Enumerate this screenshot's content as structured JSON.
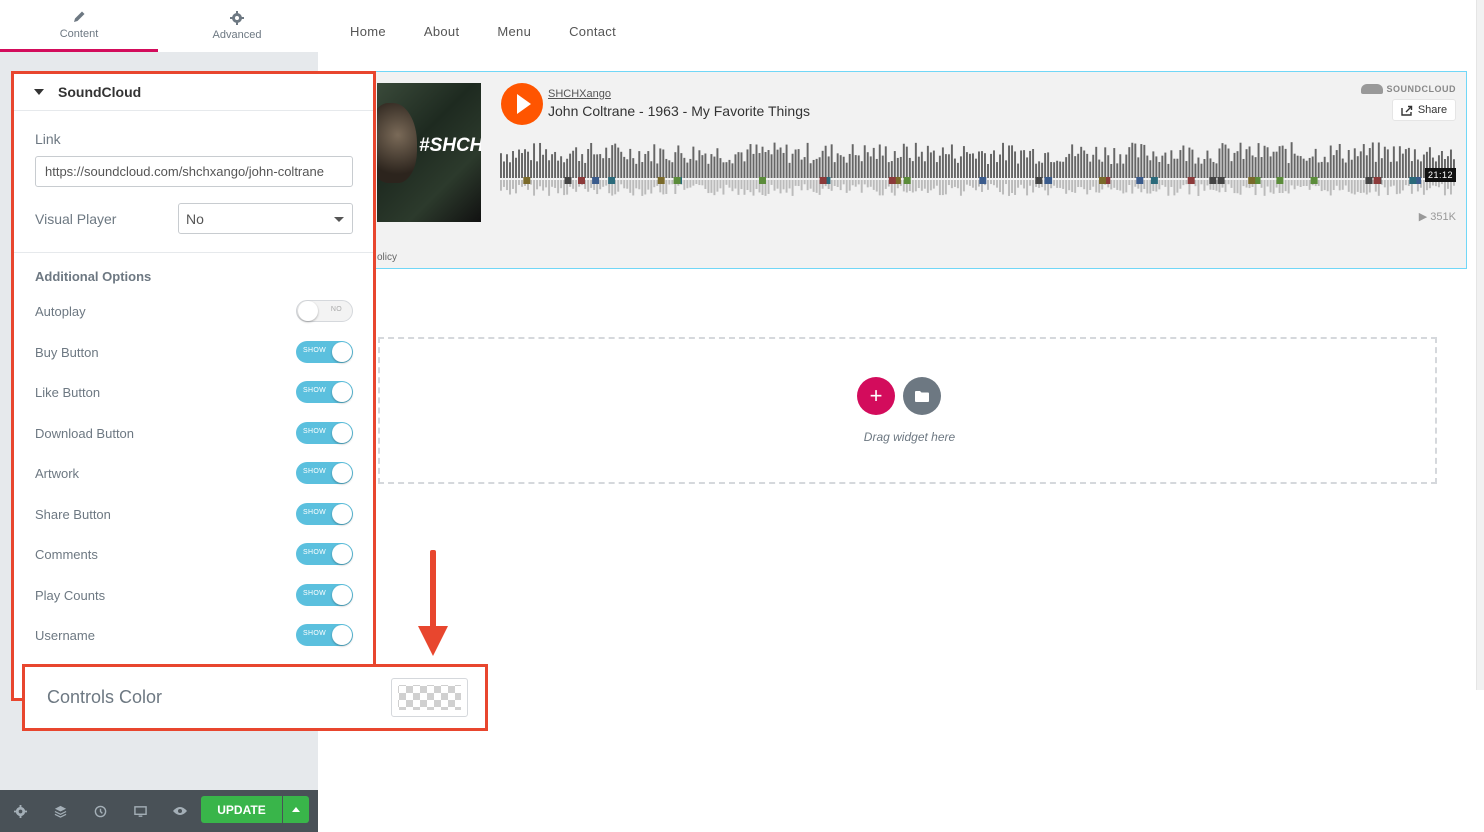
{
  "editor": {
    "tabs": [
      {
        "label": "Content",
        "icon": "pencil-icon"
      },
      {
        "label": "Advanced",
        "icon": "gear-icon"
      }
    ],
    "section": {
      "title": "SoundCloud",
      "link_label": "Link",
      "link_value": "https://soundcloud.com/shchxango/john-coltrane",
      "visual_player_label": "Visual Player",
      "visual_player_value": "No",
      "additional_options": "Additional Options",
      "options": [
        {
          "label": "Autoplay",
          "state": "NO"
        },
        {
          "label": "Buy Button",
          "state": "SHOW"
        },
        {
          "label": "Like Button",
          "state": "SHOW"
        },
        {
          "label": "Download Button",
          "state": "SHOW"
        },
        {
          "label": "Artwork",
          "state": "SHOW"
        },
        {
          "label": "Share Button",
          "state": "SHOW"
        },
        {
          "label": "Comments",
          "state": "SHOW"
        },
        {
          "label": "Play Counts",
          "state": "SHOW"
        },
        {
          "label": "Username",
          "state": "SHOW"
        }
      ]
    },
    "controls_color_label": "Controls Color",
    "bottom_bar": {
      "icons": [
        "settings-icon",
        "layers-icon",
        "history-icon",
        "responsive-icon",
        "preview-icon"
      ],
      "update_label": "UPDATE"
    }
  },
  "preview": {
    "nav": [
      "Home",
      "About",
      "Menu",
      "Contact"
    ],
    "player": {
      "artist": "SHCHXango",
      "track": "John Coltrane - 1963 - My Favorite Things",
      "artwork_text": "#SHCHX",
      "soundcloud_logo": "SOUNDCLOUD",
      "share_label": "Share",
      "duration": "21:12",
      "plays": "351K",
      "policy_fragment": "olicy"
    },
    "drop_zone_text": "Drag widget here"
  },
  "colors": {
    "accent": "#d30c5c",
    "highlight": "#e8462e",
    "toggle_on": "#5bc0de",
    "update": "#39b54a",
    "soundcloud": "#ff5500"
  }
}
